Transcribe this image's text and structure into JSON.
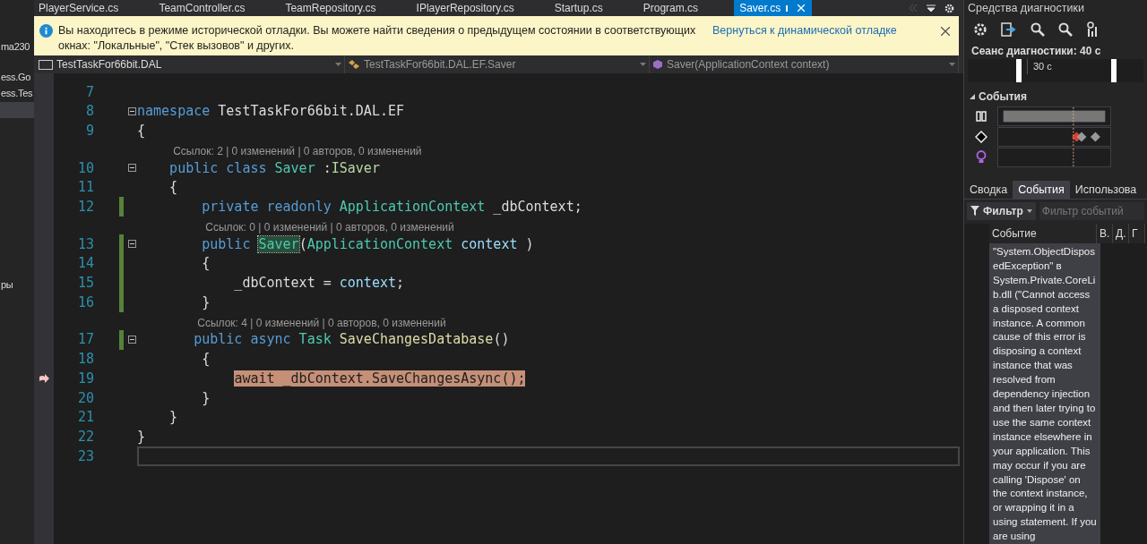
{
  "solution_explorer": {
    "items": [
      {
        "text": "ma230",
        "selected": false
      },
      {
        "text": "ess.Go",
        "selected": false
      },
      {
        "text": "ess.Tes",
        "selected": false
      },
      {
        "selected": true
      },
      {
        "text": "ры",
        "selected": false
      }
    ]
  },
  "tabs": [
    {
      "label": "PlayerService.cs",
      "selected": false
    },
    {
      "label": "TeamController.cs",
      "selected": false
    },
    {
      "label": "TeamRepository.cs",
      "selected": false
    },
    {
      "label": "IPlayerRepository.cs",
      "selected": false
    },
    {
      "label": "Startup.cs",
      "selected": false
    },
    {
      "label": "Program.cs",
      "selected": false
    },
    {
      "label": "Saver.cs",
      "selected": true
    }
  ],
  "info_bar": {
    "message": "Вы находитесь в режиме исторической отладки. Вы можете найти сведения о предыдущем состоянии в соответствующих окнах: \"Локальные\", \"Стек вызовов\" и других.",
    "link": "Вернуться к динамической отладке"
  },
  "navigation_bar": [
    {
      "kind": "project",
      "text": "TestTaskFor66bit.DAL"
    },
    {
      "kind": "class",
      "text": "TestTaskFor66bit.DAL.EF.Saver"
    },
    {
      "kind": "method",
      "text": "Saver(ApplicationContext context)"
    }
  ],
  "code": {
    "lines": [
      {
        "kind": "code",
        "number": "7",
        "changed": false,
        "foldable": false,
        "current": false,
        "cursor": false
      },
      {
        "kind": "code",
        "number": "8",
        "changed": false,
        "foldable": true,
        "current": false,
        "cursor": false,
        "tokens": [
          {
            "text": "namespace",
            "kind": "kw"
          },
          {
            "text": " TestTaskFor66bit.DAL.EF",
            "kind": "plain"
          }
        ]
      },
      {
        "kind": "code",
        "number": "9",
        "changed": false,
        "foldable": false,
        "current": false,
        "cursor": false,
        "tokens": [
          {
            "text": "{",
            "kind": "plain"
          }
        ]
      },
      {
        "kind": "lens",
        "text": "    Ссылок: 2 | 0 изменений | 0 авторов, 0 изменений"
      },
      {
        "kind": "code",
        "number": "10",
        "changed": false,
        "foldable": true,
        "current": false,
        "cursor": false,
        "tokens": [
          {
            "text": "    public class",
            "kind": "kw"
          },
          {
            "text": " Saver",
            "kind": "type"
          },
          {
            "text": " :",
            "kind": "plain"
          },
          {
            "text": "ISaver",
            "kind": "iface"
          }
        ]
      },
      {
        "kind": "code",
        "number": "11",
        "changed": false,
        "foldable": false,
        "current": false,
        "cursor": false,
        "tokens": [
          {
            "text": "    {",
            "kind": "plain"
          }
        ]
      },
      {
        "kind": "code",
        "number": "12",
        "changed": true,
        "foldable": false,
        "current": false,
        "cursor": false,
        "tokens": [
          {
            "text": "        private readonly",
            "kind": "kw"
          },
          {
            "text": " ApplicationContext",
            "kind": "type"
          },
          {
            "text": " _dbContext;",
            "kind": "plain"
          }
        ]
      },
      {
        "kind": "lens",
        "text": "        Ссылок: 0 | 0 изменений | 0 авторов, 0 изменений"
      },
      {
        "kind": "code",
        "number": "13",
        "changed": true,
        "foldable": true,
        "current": false,
        "cursor": false,
        "tokens": [
          {
            "text": "        public ",
            "kind": "kw"
          },
          {
            "text": "Saver",
            "kind": "ref"
          },
          {
            "text": "(",
            "kind": "plain"
          },
          {
            "text": "ApplicationContext",
            "kind": "type"
          },
          {
            "text": " context",
            "kind": "param"
          },
          {
            "text": " )",
            "kind": "plain"
          }
        ]
      },
      {
        "kind": "code",
        "number": "14",
        "changed": true,
        "foldable": false,
        "current": false,
        "cursor": false,
        "tokens": [
          {
            "text": "        {",
            "kind": "plain"
          }
        ]
      },
      {
        "kind": "code",
        "number": "15",
        "changed": true,
        "foldable": false,
        "current": false,
        "cursor": false,
        "tokens": [
          {
            "text": "            _dbContext = ",
            "kind": "plain"
          },
          {
            "text": "context",
            "kind": "param"
          },
          {
            "text": ";",
            "kind": "plain"
          }
        ]
      },
      {
        "kind": "code",
        "number": "16",
        "changed": true,
        "foldable": false,
        "current": false,
        "cursor": false,
        "tokens": [
          {
            "text": "        }",
            "kind": "plain"
          }
        ]
      },
      {
        "kind": "lens",
        "text": "       Ссылок: 4 | 0 изменений | 0 авторов, 0 изменений"
      },
      {
        "kind": "code",
        "number": "17",
        "changed": true,
        "foldable": true,
        "current": false,
        "cursor": false,
        "tokens": [
          {
            "text": "       public async",
            "kind": "kw"
          },
          {
            "text": " Task",
            "kind": "type"
          },
          {
            "text": " SaveChangesDatabase",
            "kind": "method"
          },
          {
            "text": "()",
            "kind": "plain"
          }
        ]
      },
      {
        "kind": "code",
        "number": "18",
        "changed": false,
        "foldable": false,
        "current": false,
        "cursor": false,
        "tokens": [
          {
            "text": "        {",
            "kind": "plain"
          }
        ]
      },
      {
        "kind": "code",
        "number": "19",
        "changed": false,
        "foldable": false,
        "current": true,
        "cursor": false,
        "tokens": [
          {
            "text": "            await _dbContext.SaveChangesAsync();",
            "kind": "active"
          }
        ]
      },
      {
        "kind": "code",
        "number": "20",
        "changed": false,
        "foldable": false,
        "current": false,
        "cursor": false,
        "tokens": [
          {
            "text": "        }",
            "kind": "plain"
          }
        ]
      },
      {
        "kind": "code",
        "number": "21",
        "changed": false,
        "foldable": false,
        "current": false,
        "cursor": false,
        "tokens": [
          {
            "text": "    }",
            "kind": "plain"
          }
        ]
      },
      {
        "kind": "code",
        "number": "22",
        "changed": false,
        "foldable": false,
        "current": false,
        "cursor": false,
        "tokens": [
          {
            "text": "}",
            "kind": "plain"
          }
        ]
      },
      {
        "kind": "code",
        "number": "23",
        "changed": false,
        "foldable": false,
        "current": false,
        "cursor": true
      }
    ]
  },
  "diagnostics": {
    "title": "Средства диагностики",
    "session": "Сеанс диагностики: 40 с",
    "timeline_label": "30 с",
    "events_section": {
      "title": "События",
      "expanded": true
    },
    "tabs": [
      {
        "label": "Сводка",
        "selected": false
      },
      {
        "label": "События",
        "selected": true
      },
      {
        "label": "Использова",
        "selected": false
      }
    ],
    "filter": {
      "label": "Фильтр",
      "placeholder": "Фильтр событий"
    },
    "table": {
      "columns": [
        "Событие",
        "В.",
        "Д.",
        "Г"
      ],
      "rows": [
        {
          "event": "\"System.ObjectDisposedException\" в System.Private.CoreLib.dll (\"Cannot access a disposed context instance. A common cause of this error is disposing a context instance that was resolved from dependency injection and then later trying to use the same context instance elsewhere in your application. This may occur if you are calling 'Dispose' on the context instance, or wrapping it in a using statement. If you are using"
        }
      ]
    }
  }
}
